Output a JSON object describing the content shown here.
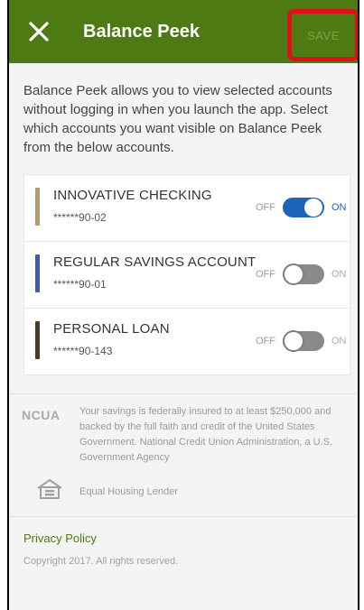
{
  "header": {
    "title": "Balance Peek",
    "save_label": "SAVE",
    "bg_color": "#4d7a12",
    "close_icon": "close-icon"
  },
  "description": "Balance Peek allows you to view selected accounts without logging in when you launch the app. Select which accounts you want visible on Balance Peek from the below accounts.",
  "accounts": [
    {
      "name": "INNOVATIVE CHECKING",
      "number": "******90-02",
      "color": "#b09a6e",
      "enabled": true,
      "off_label": "OFF",
      "on_label": "ON"
    },
    {
      "name": "REGULAR SAVINGS ACCOUNT",
      "number": "******90-01",
      "color": "#3c5bb0",
      "enabled": false,
      "off_label": "OFF",
      "on_label": "ON"
    },
    {
      "name": "PERSONAL LOAN",
      "number": "******90-143",
      "color": "#4a3b28",
      "enabled": false,
      "off_label": "OFF",
      "on_label": "ON"
    }
  ],
  "footer": {
    "ncua_logo": "NCUA",
    "ncua_text": "Your savings is federally insured to at least $250,000 and backed by the full faith and credit of the United States Government. National Credit Union Administration, a U.S. Government Agency",
    "equal_housing_text": "Equal Housing Lender",
    "privacy_label": "Privacy Policy",
    "copyright": "Copyright 2017. All rights reserved."
  },
  "colors": {
    "toggle_on": "#1d63b8",
    "toggle_off": "#8a8a8a",
    "highlight": "#e0101a"
  }
}
